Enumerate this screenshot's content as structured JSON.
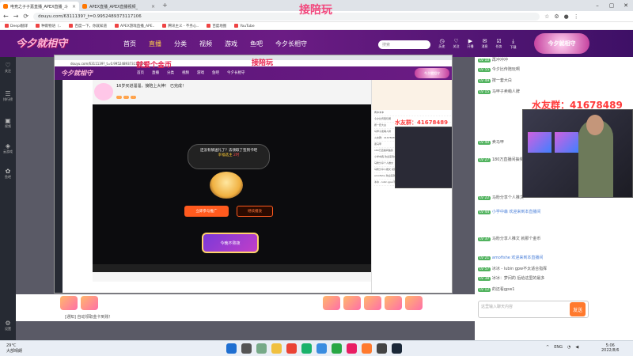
{
  "overlay_title": "接陪玩",
  "browser": {
    "tabs": [
      {
        "label": "电竞之子子嘉直播_APEX直播_斗"
      },
      {
        "label": "APEX直播_APEX直播视频_"
      }
    ],
    "url": "douyu.com/6311139?_t=0.9952489373117106",
    "bookmarks": [
      "Deepl翻译",
      "种雨物语（..",
      "百度一下，你就知道",
      "APEX游戏直播_APE..",
      "腾讯主义 - 不务心..",
      "百度地图",
      "YouTube"
    ]
  },
  "douyu": {
    "logo": "今夕就相守",
    "nav": [
      "首页",
      "直播",
      "分类",
      "视频",
      "游戏",
      "鱼吧",
      "今夕长相守"
    ],
    "active_nav": "直播",
    "search_placeholder": "搜索",
    "icons": [
      {
        "icon": "history-icon",
        "label": "历史"
      },
      {
        "icon": "follow-icon",
        "label": "关注"
      },
      {
        "icon": "live-icon",
        "label": "开播"
      },
      {
        "icon": "msg-icon",
        "label": "消息"
      },
      {
        "icon": "task-icon",
        "label": "任务"
      },
      {
        "icon": "download-icon",
        "label": "下载"
      }
    ],
    "side": [
      {
        "icon": "follow-icon",
        "label": "关注"
      },
      {
        "icon": "category-icon",
        "label": "排行榜"
      },
      {
        "icon": "video-icon",
        "label": "视频"
      },
      {
        "icon": "game-icon",
        "label": "云游戏"
      },
      {
        "icon": "fish-icon",
        "label": "鱼吧"
      }
    ],
    "side_bottom": {
      "icon": "settings-icon",
      "label": "设置"
    }
  },
  "mini": {
    "caption_coin": "就爱个金币",
    "caption_top": "接陪玩",
    "room_title": "16岁买进溜溜，接陪上大神！ 已完成！",
    "popup_line1": "还没有够送礼了？去领取了签到卡吧",
    "popup_y": "幸福选主",
    "popup_r": "2时",
    "btn_primary": "立即参与推广",
    "btn_secondary": "继续播放",
    "promo": "今晚不熬夜"
  },
  "chat_watermark": "水友群：41678489",
  "chat_lines": [
    {
      "lv": "LV 10",
      "text": "再冲冲冲"
    },
    {
      "lv": "LV 55",
      "text": "今夕比传陪玩啊"
    },
    {
      "lv": "LV 49",
      "text": "按一套大白"
    },
    {
      "lv": "LV 15",
      "text": "马甲子卖萌人牌"
    },
    {
      "lv": "LV 44",
      "text": "火友群：41678489"
    },
    {
      "lv": "LV 40",
      "text": "卖马甲"
    },
    {
      "lv": "LV 27",
      "text": "180万直播间抽奖"
    },
    {
      "lv": "LV 44",
      "text": "小学中森 欢迎来到本直播间"
    },
    {
      "lv": "LV 22",
      "text": "马粉分享个人推文"
    },
    {
      "lv": "LV 37",
      "text": "马粉分享人推文 就那个金币"
    },
    {
      "lv": "LV 21",
      "text": "amofishe 欢迎来到本直播间"
    },
    {
      "lv": "LV 57",
      "text": "冰冰 - lubin gpw不太适合指挥"
    },
    {
      "lv": "LV 38",
      "text": "冰冰：梦间的 后给这里的最多"
    },
    {
      "lv": "LV 12",
      "text": "的还看gpw1"
    }
  ],
  "chat_placeholder": "这里输入聊天内容",
  "send_label": "发送",
  "bottom_info": "[通知] 自动领取金卡到账！",
  "taskbar": {
    "weather_temp": "29°C",
    "weather_desc": "大部晴朗",
    "lang": "ENG",
    "time": "5:06",
    "date": "2022/8/6"
  },
  "colors": {
    "douyu_purple": "#5a1478",
    "accent_orange": "#ff7a2e",
    "overlay_pink": "#f2467c",
    "watermark_red": "#ff3b3b"
  }
}
